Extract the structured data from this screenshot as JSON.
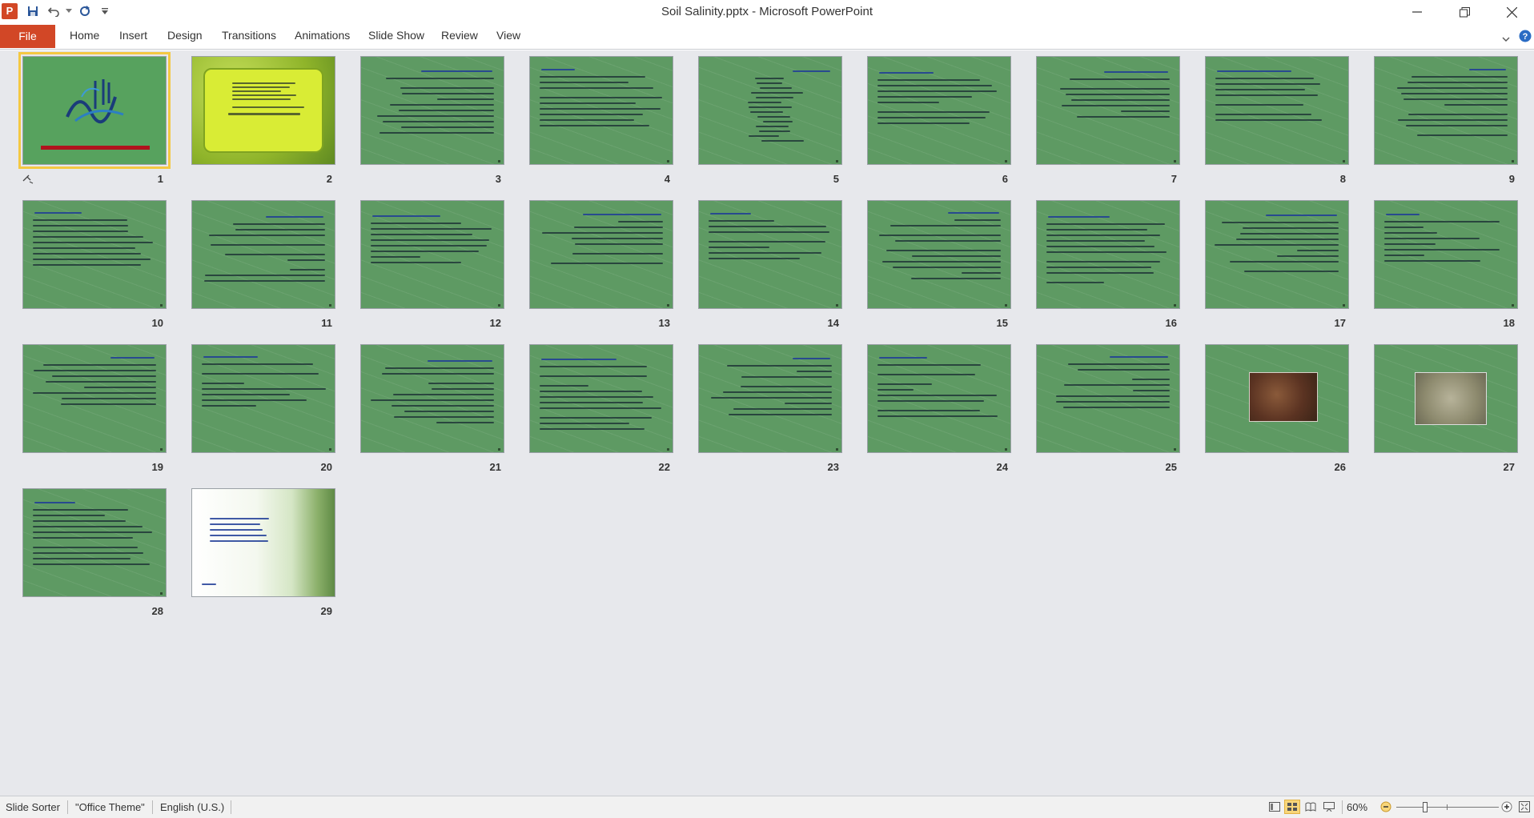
{
  "window": {
    "title": "Soil Salinity.pptx  -  Microsoft PowerPoint",
    "app_logo_letter": "P"
  },
  "ribbon": {
    "file_label": "File",
    "tabs": [
      "Home",
      "Insert",
      "Design",
      "Transitions",
      "Animations",
      "Slide Show",
      "Review",
      "View"
    ]
  },
  "slides": [
    {
      "number": "1",
      "kind": "title"
    },
    {
      "number": "2",
      "kind": "leaf"
    },
    {
      "number": "3",
      "kind": "text"
    },
    {
      "number": "4",
      "kind": "text"
    },
    {
      "number": "5",
      "kind": "list"
    },
    {
      "number": "6",
      "kind": "text"
    },
    {
      "number": "7",
      "kind": "text"
    },
    {
      "number": "8",
      "kind": "text"
    },
    {
      "number": "9",
      "kind": "text"
    },
    {
      "number": "10",
      "kind": "text"
    },
    {
      "number": "11",
      "kind": "text"
    },
    {
      "number": "12",
      "kind": "text"
    },
    {
      "number": "13",
      "kind": "text"
    },
    {
      "number": "14",
      "kind": "text"
    },
    {
      "number": "15",
      "kind": "text"
    },
    {
      "number": "16",
      "kind": "text"
    },
    {
      "number": "17",
      "kind": "text"
    },
    {
      "number": "18",
      "kind": "text"
    },
    {
      "number": "19",
      "kind": "text"
    },
    {
      "number": "20",
      "kind": "text"
    },
    {
      "number": "21",
      "kind": "text"
    },
    {
      "number": "22",
      "kind": "text"
    },
    {
      "number": "23",
      "kind": "text"
    },
    {
      "number": "24",
      "kind": "text"
    },
    {
      "number": "25",
      "kind": "text"
    },
    {
      "number": "26",
      "kind": "photo-soil"
    },
    {
      "number": "27",
      "kind": "photo-ground"
    },
    {
      "number": "28",
      "kind": "text"
    },
    {
      "number": "29",
      "kind": "forest"
    }
  ],
  "statusbar": {
    "view_name": "Slide Sorter",
    "theme": "\"Office Theme\"",
    "language": "English (U.S.)",
    "zoom": "60%",
    "zoom_level_percent": 60
  },
  "colors": {
    "file_tab": "#d24726",
    "slide_green": "#5e9a63",
    "selection": "#f4c842"
  }
}
